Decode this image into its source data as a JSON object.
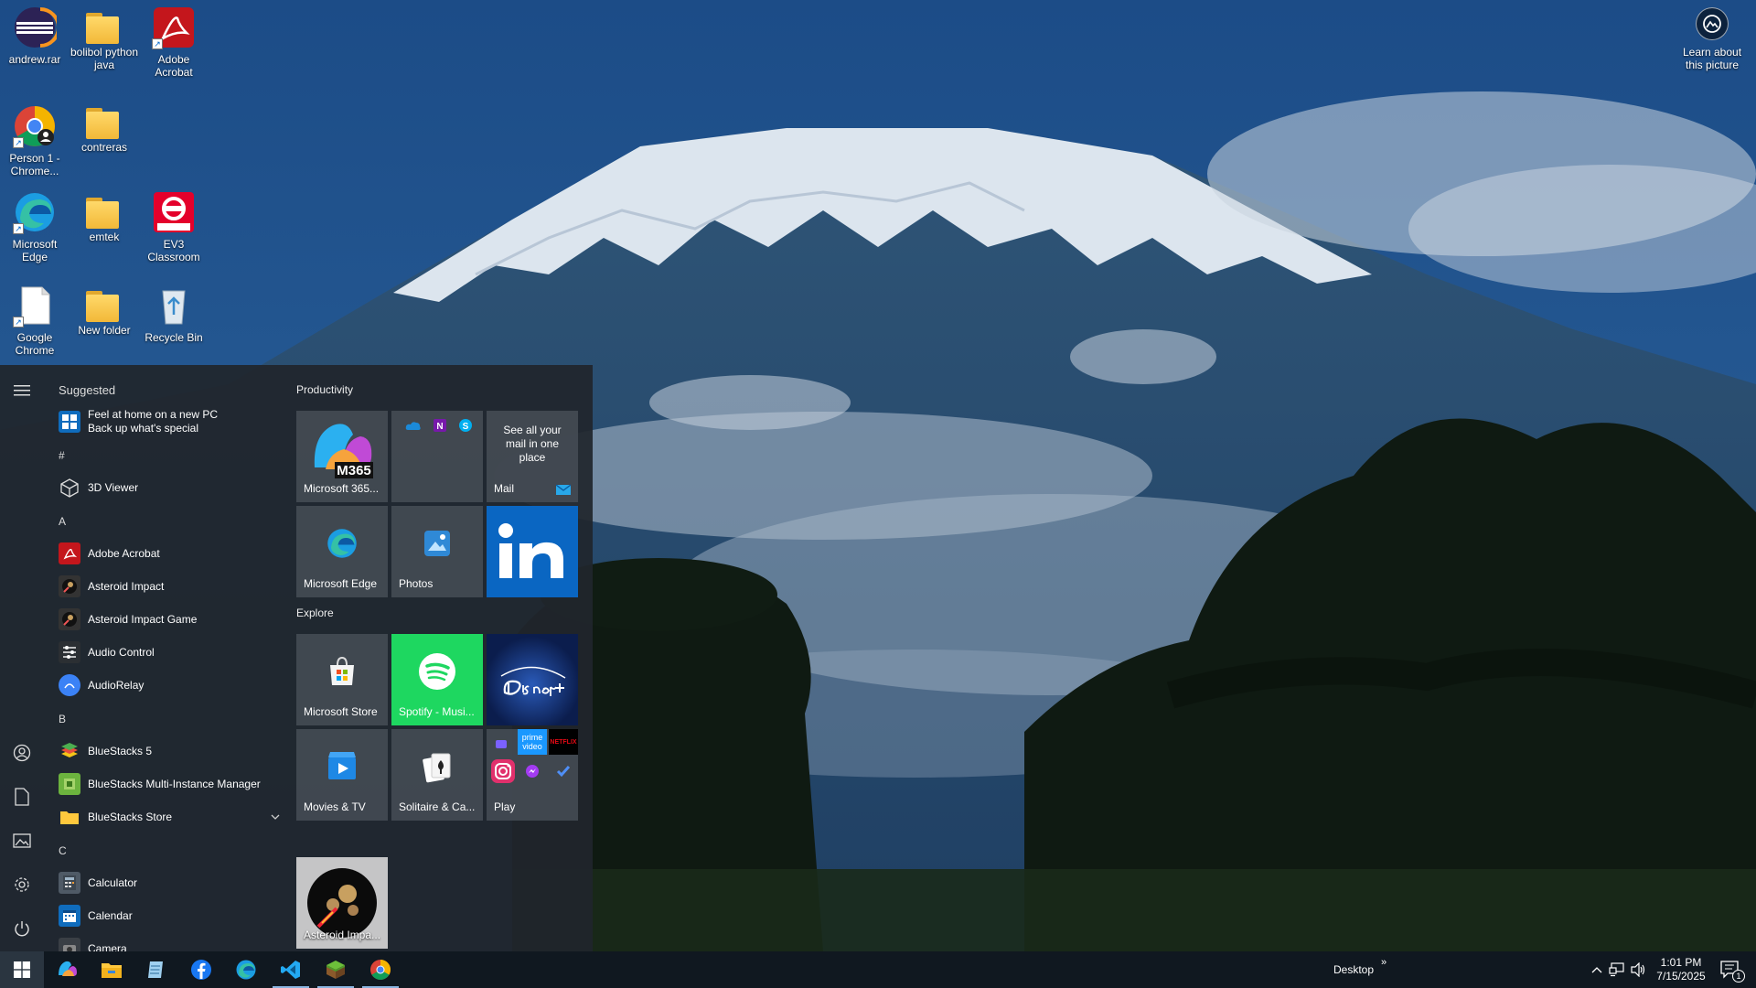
{
  "desktop": {
    "icons": [
      {
        "label": "andrew.rar"
      },
      {
        "label": "bolibol python java"
      },
      {
        "label": "Adobe Acrobat"
      },
      {
        "label": "Person 1 - Chrome..."
      },
      {
        "label": "contreras"
      },
      {
        "label": "Microsoft Edge"
      },
      {
        "label": "emtek"
      },
      {
        "label": "EV3 Classroom"
      },
      {
        "label": "Google Chrome"
      },
      {
        "label": "New folder"
      },
      {
        "label": "Recycle Bin"
      }
    ],
    "learn_about": "Learn about this picture"
  },
  "start_menu": {
    "suggested_heading": "Suggested",
    "suggested_item": {
      "line1": "Feel at home on a new PC",
      "line2": "Back up what's special"
    },
    "sections": {
      "hash": "#",
      "a": "A",
      "b": "B",
      "c": "C"
    },
    "apps": {
      "viewer3d": "3D Viewer",
      "acrobat": "Adobe Acrobat",
      "asteroid": "Asteroid Impact",
      "asteroid_game": "Asteroid Impact Game",
      "audio_control": "Audio Control",
      "audiorelay": "AudioRelay",
      "bluestacks5": "BlueStacks 5",
      "bluestacks_multi": "BlueStacks Multi-Instance Manager",
      "bluestacks_store": "BlueStacks Store",
      "calculator": "Calculator",
      "calendar": "Calendar",
      "camera": "Camera"
    },
    "groups": {
      "productivity": "Productivity",
      "explore": "Explore"
    },
    "tiles": {
      "m365": "Microsoft 365...",
      "m365_badge": "M365",
      "mail_text": "See all your mail in one place",
      "mail": "Mail",
      "edge": "Microsoft Edge",
      "photos": "Photos",
      "store": "Microsoft Store",
      "spotify": "Spotify - Musi...",
      "movies": "Movies & TV",
      "solitaire": "Solitaire & Ca...",
      "play": "Play",
      "prime": "prime video",
      "netflix": "NETFLIX",
      "asteroid_tile": "Asteroid Impa..."
    }
  },
  "taskbar": {
    "desktop_label": "Desktop",
    "desktop_chevron": "»",
    "time": "1:01 PM",
    "date": "7/15/2025",
    "notification_count": "1"
  },
  "colors": {
    "accent": "#0f6cbd",
    "linkedin": "#0a66c2",
    "spotify": "#1ed760",
    "disney": "#0b1d4d",
    "taskbar": "#101820"
  }
}
